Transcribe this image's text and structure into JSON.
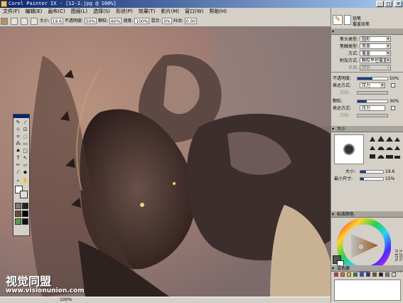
{
  "window": {
    "title": "Corel Painter IX - [12-2.jpg @ 100%]",
    "minimize": "_",
    "maximize": "□",
    "close": "×"
  },
  "menu": [
    "文件(F)",
    "编辑(E)",
    "画布(C)",
    "图层(L)",
    "选择(S)",
    "形状(P)",
    "效果(T)",
    "影片(M)",
    "窗口(W)",
    "帮助(H)"
  ],
  "property_bar": {
    "size_label": "大小:",
    "size_value": "19.6",
    "opacity_label": "不透明度:",
    "opacity_value": "50%",
    "grain_label": "颗粒:",
    "grain_value": "60%",
    "rate_label": "速度:",
    "rate_value": "100%",
    "blend_label": "混合:",
    "blend_value": "0%",
    "jitter_label": "抖动:",
    "jitter_value": "0.00"
  },
  "brush_selector": {
    "category": "铅笔",
    "variant": "覆盖铅笔"
  },
  "brush_controls": {
    "rows": [
      {
        "label": "笔头类型:",
        "value": "圆形"
      },
      {
        "label": "笔触类型:",
        "value": "简单"
      },
      {
        "label": "方式:",
        "value": "覆盖"
      },
      {
        "label": "附加方式:",
        "value": "颗粒平坦覆盖"
      },
      {
        "label": "来源:",
        "value": "颜色"
      }
    ],
    "opacity": {
      "label": "不透明度:",
      "value": "50%",
      "level": 0.5
    },
    "expression_label": "表达方式:",
    "expression_value": "压力",
    "direction_label": "方向:",
    "grain": {
      "label": "颗粒:",
      "value": "30%",
      "level": 0.3
    },
    "expression2_label": "表达方式:",
    "expression2_value": "压力",
    "direction2_label": "方向:"
  },
  "size_panel": {
    "title": "大小",
    "size_label": "大小:",
    "size_value": "19.6",
    "size_level": 0.25,
    "min_size_label": "最小尺寸:",
    "min_size_value": "15%",
    "min_size_level": 0.15
  },
  "color_panel": {
    "title": "标准颜色",
    "h_value": "H 63%",
    "s_value": "S 25%",
    "v_value": "V 64%"
  },
  "mixer_panel": {
    "title": "混色器",
    "swatches": [
      "#c23a2a",
      "#e06a1a",
      "#e8b82a",
      "#3a7a3a",
      "#2a5aa8",
      "#3a2a6a",
      "#8a4a2a",
      "#1a1a1a",
      "#7a7a7a",
      "#d8d8d8"
    ]
  },
  "status": {
    "zoom": "100%"
  },
  "watermark": {
    "brand": "视觉同盟",
    "url": "www.visionunion.com"
  },
  "colors": {
    "title_bar": "#0a246a",
    "panel_bg": "#d4d0c8"
  }
}
